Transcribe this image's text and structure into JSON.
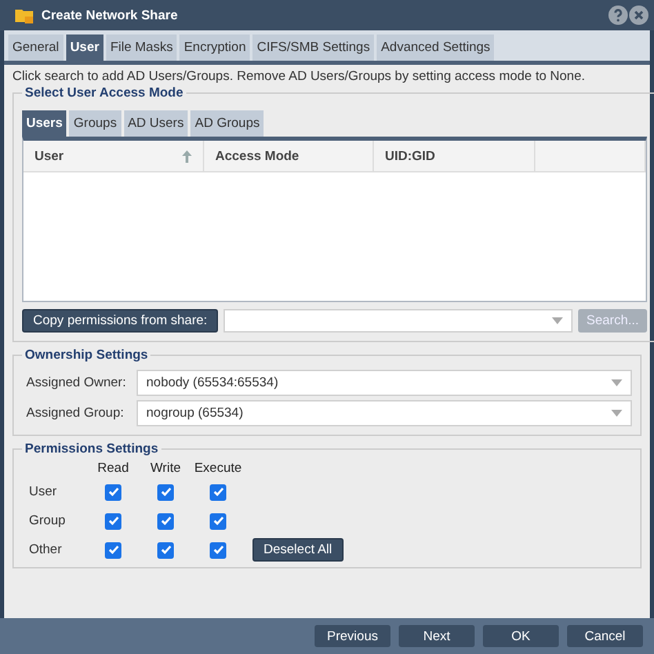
{
  "window": {
    "title": "Create Network Share"
  },
  "tabs": [
    {
      "label": "General",
      "selected": false
    },
    {
      "label": "User",
      "selected": true
    },
    {
      "label": "File Masks",
      "selected": false
    },
    {
      "label": "Encryption",
      "selected": false
    },
    {
      "label": "CIFS/SMB Settings",
      "selected": false
    },
    {
      "label": "Advanced Settings",
      "selected": false
    }
  ],
  "description": "Click search to add AD Users/Groups. Remove AD Users/Groups by setting access mode to None.",
  "access_mode": {
    "legend": "Select User Access Mode",
    "tabs": [
      {
        "label": "Users",
        "selected": true
      },
      {
        "label": "Groups",
        "selected": false
      },
      {
        "label": "AD Users",
        "selected": false
      },
      {
        "label": "AD Groups",
        "selected": false
      }
    ],
    "columns": [
      {
        "label": "User",
        "sorted": true
      },
      {
        "label": "Access Mode",
        "sorted": false
      },
      {
        "label": "UID:GID",
        "sorted": false
      }
    ],
    "copy_button": "Copy permissions from share:",
    "search_button": {
      "label": "Search...",
      "disabled": true
    }
  },
  "ownership": {
    "legend": "Ownership Settings",
    "fields": [
      {
        "label": "Assigned Owner:",
        "value": "nobody (65534:65534)"
      },
      {
        "label": "Assigned Group:",
        "value": "nogroup (65534)"
      }
    ]
  },
  "permissions": {
    "legend": "Permissions Settings",
    "columns": [
      "Read",
      "Write",
      "Execute"
    ],
    "rows": [
      {
        "label": "User",
        "checks": [
          true,
          true,
          true
        ]
      },
      {
        "label": "Group",
        "checks": [
          true,
          true,
          true
        ]
      },
      {
        "label": "Other",
        "checks": [
          true,
          true,
          true
        ]
      }
    ],
    "deselect_button": "Deselect All"
  },
  "buttons": [
    "Previous",
    "Next",
    "OK",
    "Cancel"
  ]
}
